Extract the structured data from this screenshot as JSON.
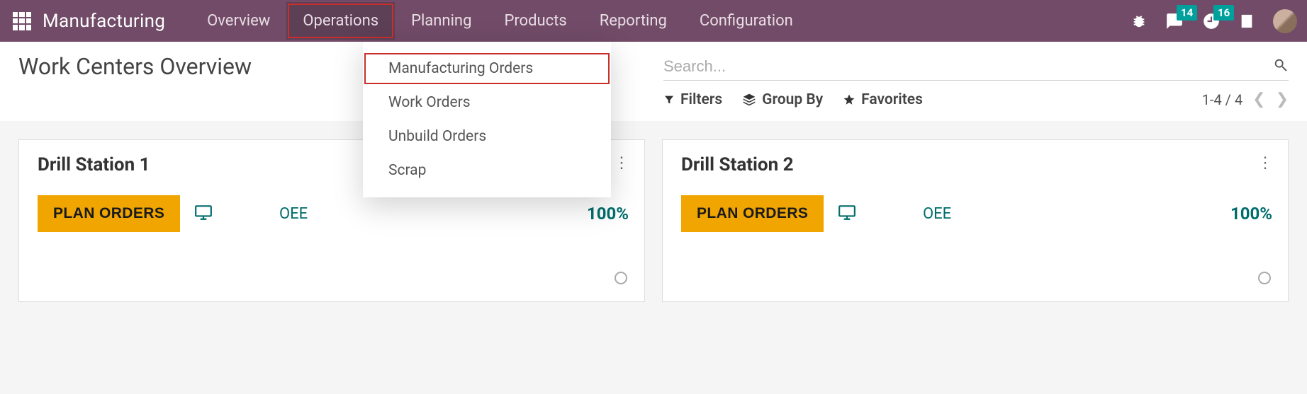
{
  "brand": "Manufacturing",
  "nav": {
    "overview": "Overview",
    "operations": "Operations",
    "planning": "Planning",
    "products": "Products",
    "reporting": "Reporting",
    "configuration": "Configuration"
  },
  "dropdown": {
    "manufacturing_orders": "Manufacturing Orders",
    "work_orders": "Work Orders",
    "unbuild_orders": "Unbuild Orders",
    "scrap": "Scrap"
  },
  "page_title": "Work Centers Overview",
  "search": {
    "placeholder": "Search...",
    "value": ""
  },
  "toolbar": {
    "filters": "Filters",
    "group_by": "Group By",
    "favorites": "Favorites"
  },
  "pager": {
    "range": "1-4 / 4"
  },
  "badges": {
    "chat": "14",
    "activity": "16"
  },
  "cards": [
    {
      "title": "Drill Station 1",
      "plan_label": "PLAN ORDERS",
      "oee_label": "OEE",
      "oee_value": "100%"
    },
    {
      "title": "Drill Station 2",
      "plan_label": "PLAN ORDERS",
      "oee_label": "OEE",
      "oee_value": "100%"
    }
  ]
}
